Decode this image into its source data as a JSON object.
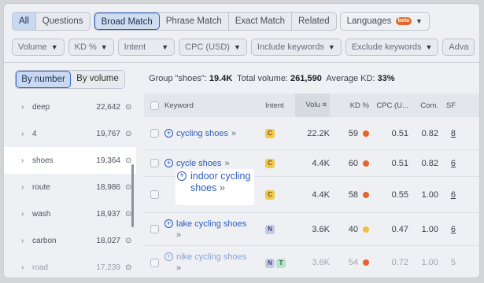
{
  "tabs": {
    "group1": [
      "All",
      "Questions"
    ],
    "group2": [
      "Broad Match",
      "Phrase Match",
      "Exact Match",
      "Related"
    ],
    "languages": "Languages",
    "beta": "beta"
  },
  "filters": [
    "Volume",
    "KD %",
    "Intent",
    "CPC (USD)",
    "Include keywords",
    "Exclude keywords",
    "Adva"
  ],
  "sidebar": {
    "toggle": [
      "By number",
      "By volume"
    ],
    "items": [
      {
        "name": "deep",
        "count": "22,642"
      },
      {
        "name": "4",
        "count": "19,767"
      },
      {
        "name": "shoes",
        "count": "19,364"
      },
      {
        "name": "route",
        "count": "18,986"
      },
      {
        "name": "wash",
        "count": "18,937"
      },
      {
        "name": "carbon",
        "count": "18,027"
      },
      {
        "name": "road",
        "count": "17,239"
      }
    ]
  },
  "group_info": {
    "prefix": "Group \"shoes\": ",
    "group_count": "19.4K",
    "total_label": "  Total volume: ",
    "total_volume": "261,590",
    "kd_label": "  Average KD: ",
    "avg_kd": "33%"
  },
  "table": {
    "headers": {
      "keyword": "Keyword",
      "intent": "Intent",
      "volume": "Volu",
      "kd": "KD %",
      "cpc": "CPC (U...",
      "com": "Com.",
      "sf": "SF"
    },
    "rows": [
      {
        "keyword": "cycling shoes",
        "intent": [
          "C"
        ],
        "volume": "22.2K",
        "kd": "59",
        "kd_color": "orange",
        "cpc": "0.51",
        "com": "0.82",
        "sf": "8"
      },
      {
        "keyword": "cycle shoes",
        "intent": [
          "C"
        ],
        "volume": "4.4K",
        "kd": "60",
        "kd_color": "orange",
        "cpc": "0.51",
        "com": "0.82",
        "sf": "6"
      },
      {
        "keyword": "indoor cycling shoes",
        "intent": [
          "C"
        ],
        "volume": "4.4K",
        "kd": "58",
        "kd_color": "orange",
        "cpc": "0.55",
        "com": "1.00",
        "sf": "6"
      },
      {
        "keyword": "lake cycling shoes",
        "intent": [
          "N"
        ],
        "volume": "3.6K",
        "kd": "40",
        "kd_color": "yellow",
        "cpc": "0.47",
        "com": "1.00",
        "sf": "6"
      },
      {
        "keyword": "nike cycling shoes",
        "intent": [
          "N",
          "T"
        ],
        "volume": "3.6K",
        "kd": "54",
        "kd_color": "orange",
        "cpc": "0.72",
        "com": "1.00",
        "sf": "5"
      }
    ]
  },
  "highlight": {
    "line1": "indoor cycling",
    "line2": "shoes"
  },
  "colors": {
    "accent": "#2a63c6",
    "link": "#2f5db8",
    "kd_orange": "#e8642a",
    "kd_yellow": "#edc13b",
    "beta": "#e06a2a"
  }
}
